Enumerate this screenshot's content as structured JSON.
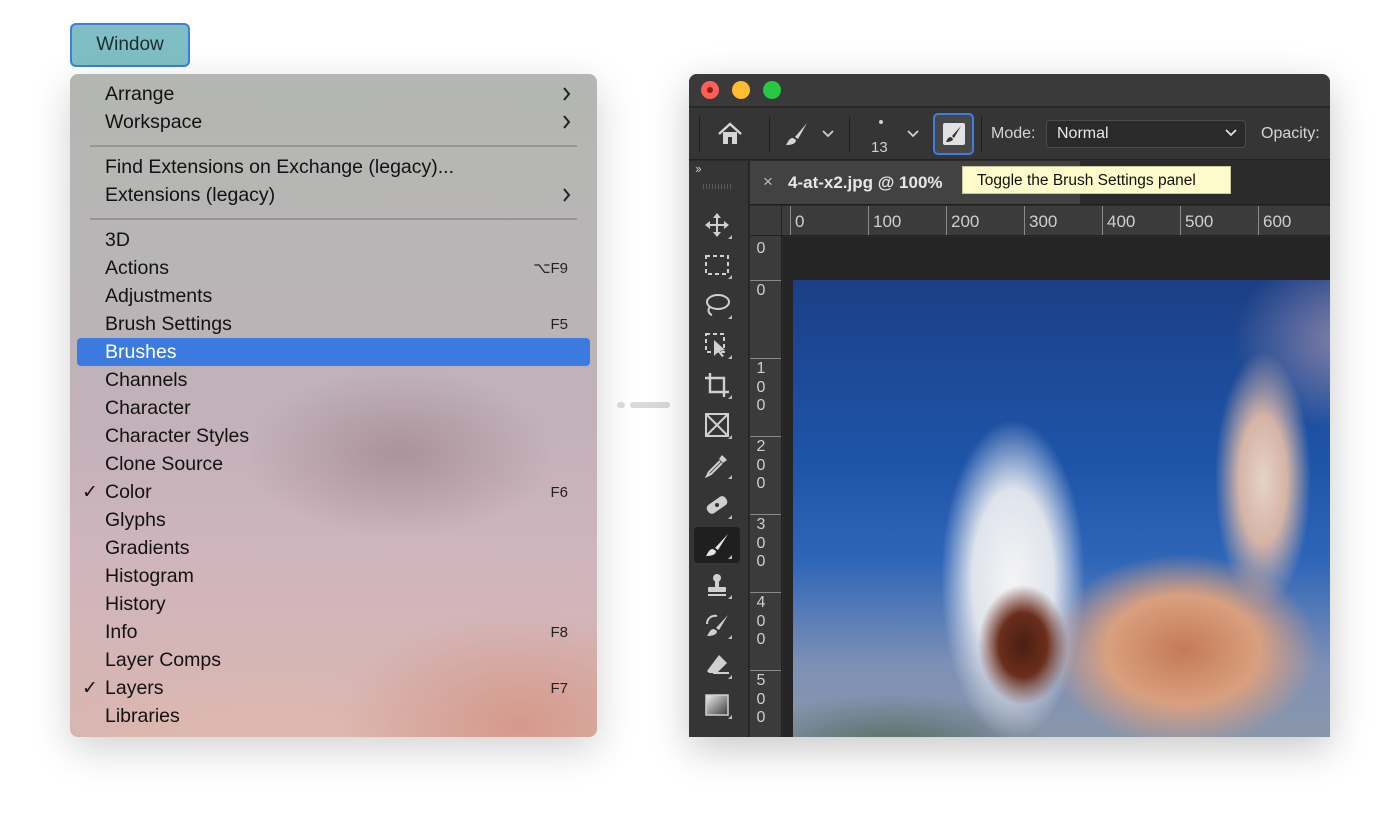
{
  "menu_button": {
    "label": "Window"
  },
  "menu": {
    "items": [
      {
        "label": "Arrange",
        "submenu": true
      },
      {
        "label": "Workspace",
        "submenu": true
      },
      {
        "label": "Find Extensions on Exchange (legacy)..."
      },
      {
        "label": "Extensions (legacy)",
        "submenu": true
      },
      {
        "label": "3D"
      },
      {
        "label": "Actions",
        "shortcut": "⌥F9"
      },
      {
        "label": "Adjustments"
      },
      {
        "label": "Brush Settings",
        "shortcut": "F5"
      },
      {
        "label": "Brushes",
        "highlighted": true
      },
      {
        "label": "Channels"
      },
      {
        "label": "Character"
      },
      {
        "label": "Character Styles"
      },
      {
        "label": "Clone Source"
      },
      {
        "label": "Color",
        "shortcut": "F6",
        "checked": true
      },
      {
        "label": "Glyphs"
      },
      {
        "label": "Gradients"
      },
      {
        "label": "Histogram"
      },
      {
        "label": "History"
      },
      {
        "label": "Info",
        "shortcut": "F8"
      },
      {
        "label": "Layer Comps"
      },
      {
        "label": "Layers",
        "shortcut": "F7",
        "checked": true
      },
      {
        "label": "Libraries"
      }
    ],
    "check_glyph": "✓"
  },
  "photoshop": {
    "options_bar": {
      "brush_size": "13",
      "mode_label": "Mode:",
      "mode_value": "Normal",
      "opacity_label": "Opacity:"
    },
    "toolbar": {
      "collapse_glyph": "››",
      "tools": [
        "move-icon",
        "marquee-icon",
        "lasso-icon",
        "object-select-icon",
        "crop-icon",
        "frame-icon",
        "eyedropper-icon",
        "healing-brush-icon",
        "brush-icon",
        "stamp-icon",
        "history-brush-icon",
        "eraser-icon",
        "gradient-icon"
      ],
      "active_tool": "brush-icon"
    },
    "document_tab": {
      "close_glyph": "×",
      "title": "4-at-x2.jpg @ 100%"
    },
    "tooltip": "Toggle the Brush Settings panel",
    "ruler_top_labels": [
      "0",
      "100",
      "200",
      "300",
      "400",
      "500",
      "600"
    ],
    "ruler_left_labels": [
      "0",
      "0",
      "1\n0\n0",
      "2\n0\n0",
      "3\n0\n0",
      "4\n0\n0",
      "5\n0\n0"
    ]
  },
  "colors": {
    "accent_blue": "#3b7be0",
    "button_teal": "#7fbfc4",
    "tooltip_yellow": "#fdfbc9"
  }
}
